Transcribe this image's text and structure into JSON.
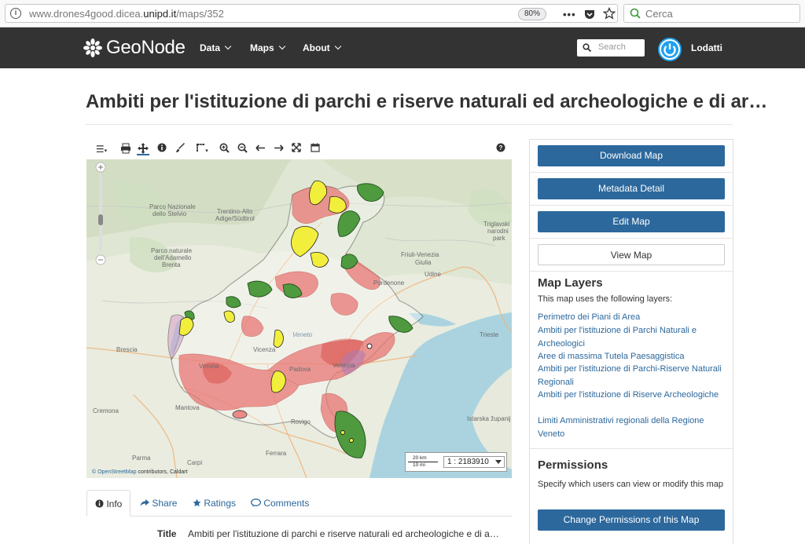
{
  "browser": {
    "url_prefix": "www.drones4good.dicea.",
    "url_domain": "unipd.it",
    "url_path": "/maps/352",
    "zoom": "80%",
    "search_placeholder": "Cerca"
  },
  "navbar": {
    "logo_text": "GeoNode",
    "items": [
      {
        "label": "Data"
      },
      {
        "label": "Maps"
      },
      {
        "label": "About"
      }
    ],
    "search_placeholder": "Search",
    "username": "Lodatti"
  },
  "page": {
    "title": "Ambiti per l'istituzione di parchi e riserve naturali ed archeologiche e di ar…"
  },
  "map": {
    "scale_top": "20 km",
    "scale_bottom": "10 mi",
    "scale_ratio": "1 : 2183910",
    "attribution_link": "© OpenStreetMap",
    "attribution_text": " contributors, Caldart",
    "labels": [
      {
        "text": "Parco Nazionale"
      },
      {
        "text": "dello Stelvio"
      },
      {
        "text": "Parco naturale"
      },
      {
        "text": "dell'Adamello"
      },
      {
        "text": "Brenta"
      },
      {
        "text": "Trentino-Alto"
      },
      {
        "text": "Adige/Südtirol"
      },
      {
        "text": "Friuli-Venezia"
      },
      {
        "text": "Giulia"
      },
      {
        "text": "Udine"
      },
      {
        "text": "Pordenone"
      },
      {
        "text": "Triglavski"
      },
      {
        "text": "narodni"
      },
      {
        "text": "park"
      },
      {
        "text": "Brescia"
      },
      {
        "text": "Verona"
      },
      {
        "text": "Vicenza"
      },
      {
        "text": "Padova"
      },
      {
        "text": "Venezia"
      },
      {
        "text": "Trieste"
      },
      {
        "text": "Mantova"
      },
      {
        "text": "Rovigo"
      },
      {
        "text": "Cremona"
      },
      {
        "text": "Parma"
      },
      {
        "text": "Carpi"
      },
      {
        "text": "Ferrara"
      },
      {
        "text": "Veneto"
      },
      {
        "text": "Istarska županij"
      }
    ]
  },
  "tabs": [
    {
      "icon": "info-icon",
      "label": "Info"
    },
    {
      "icon": "share-icon",
      "label": "Share"
    },
    {
      "icon": "star-icon",
      "label": "Ratings"
    },
    {
      "icon": "comment-icon",
      "label": "Comments"
    }
  ],
  "info": {
    "title_key": "Title",
    "title_value": "Ambiti per l'istituzione di parchi e riserve naturali ed archeologiche e di a…"
  },
  "panel": {
    "download_label": "Download Map",
    "metadata_label": "Metadata Detail",
    "edit_label": "Edit Map",
    "view_label": "View Map",
    "layers_heading": "Map Layers",
    "layers_intro": "This map uses the following layers:",
    "layers": [
      "Perimetro dei Piani di Area",
      "Ambiti per l'istituzione di Parchi Naturali e Archeologici",
      "Aree di massima Tutela Paesaggistica",
      "Ambiti per l'istituzione di Parchi-Riserve Naturali Regionali",
      "Ambiti per l'istituzione di Riserve Archeologiche",
      "Limiti Amministrativi regionali della Regione Veneto"
    ],
    "permissions_heading": "Permissions",
    "permissions_text": "Specify which users can view or modify this map",
    "permissions_button": "Change Permissions of this Map"
  },
  "colors": {
    "navbar": "#333333",
    "primary": "#2c689c",
    "link": "#2c689c",
    "layer_red": "#e8726f",
    "layer_green": "#4f9a3f",
    "layer_yellow": "#f2ee3c",
    "sea": "#aad3df"
  }
}
